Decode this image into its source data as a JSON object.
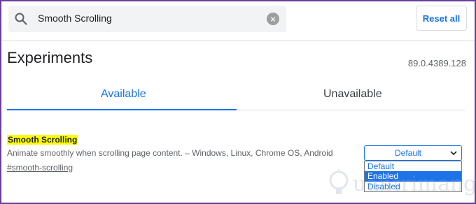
{
  "search": {
    "value": "Smooth Scrolling",
    "icon": "search-icon",
    "clear_icon": "close-icon"
  },
  "header": {
    "reset_label": "Reset all"
  },
  "page": {
    "title": "Experiments",
    "version": "89.0.4389.128"
  },
  "tabs": [
    {
      "label": "Available",
      "active": true
    },
    {
      "label": "Unavailable",
      "active": false
    }
  ],
  "experiment": {
    "title": "Smooth Scrolling",
    "description": "Animate smoothly when scrolling page content. – Windows, Linux, Chrome OS, Android",
    "link": "#smooth-scrolling",
    "select": {
      "value": "Default",
      "options": [
        "Default",
        "Enabled",
        "Disabled"
      ],
      "highlighted": "Enabled"
    }
  },
  "watermark": {
    "text": "uantrimang"
  },
  "colors": {
    "accent": "#1a73e8",
    "highlight": "#ffff00",
    "frame": "#6a3d9a"
  }
}
